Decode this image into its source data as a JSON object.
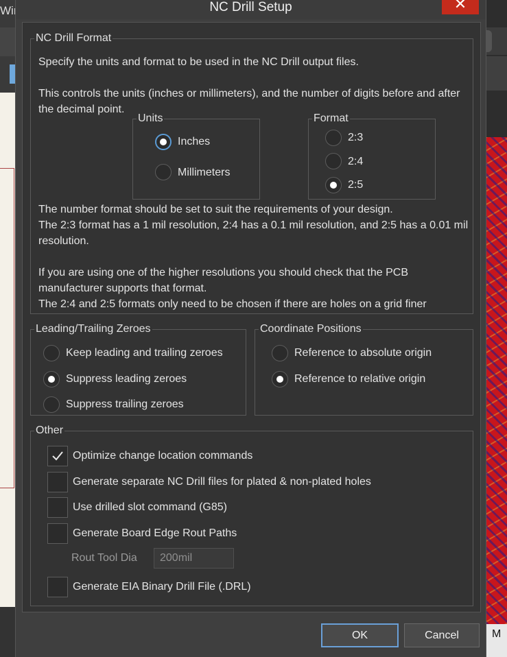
{
  "background": {
    "left_title": "Wir",
    "right_label": "M"
  },
  "dialog": {
    "title": "NC Drill Setup",
    "close_glyph": "✕",
    "ok_label": "OK",
    "cancel_label": "Cancel"
  },
  "nc_format": {
    "legend": "NC Drill Format",
    "desc1": "Specify the units and format to be used in the NC Drill output files.",
    "desc2": "This controls the units (inches or millimeters), and the number of digits before and after the decimal point.",
    "units": {
      "legend": "Units",
      "options": [
        {
          "label": "Inches",
          "selected": true
        },
        {
          "label": "Millimeters",
          "selected": false
        }
      ]
    },
    "format": {
      "legend": "Format",
      "options": [
        {
          "label": "2:3",
          "selected": false
        },
        {
          "label": "2:4",
          "selected": false
        },
        {
          "label": "2:5",
          "selected": true
        }
      ]
    },
    "note1": "The number format should be set to suit the requirements of your design.",
    "note2": "The 2:3 format has a 1 mil resolution, 2:4 has a 0.1 mil resolution, and 2:5 has a 0.01 mil resolution.",
    "note3": "If you are using one of the higher resolutions you should check that the PCB manufacturer supports that format.",
    "note4": "The 2:4 and 2:5 formats only need to be chosen if there are holes on a grid finer"
  },
  "zeroes": {
    "legend": "Leading/Trailing Zeroes",
    "options": [
      {
        "label": "Keep leading and trailing zeroes",
        "selected": false
      },
      {
        "label": "Suppress leading zeroes",
        "selected": true
      },
      {
        "label": "Suppress trailing zeroes",
        "selected": false
      }
    ]
  },
  "coords": {
    "legend": "Coordinate Positions",
    "options": [
      {
        "label": "Reference to absolute origin",
        "selected": false
      },
      {
        "label": "Reference to relative origin",
        "selected": true
      }
    ]
  },
  "other": {
    "legend": "Other",
    "items": [
      {
        "label": "Optimize change location commands",
        "checked": true
      },
      {
        "label": "Generate separate NC Drill files for plated & non-plated holes",
        "checked": false
      },
      {
        "label": "Use drilled slot command (G85)",
        "checked": false
      },
      {
        "label": "Generate Board Edge Rout Paths",
        "checked": false
      }
    ],
    "rout_tool_label": "Rout Tool Dia",
    "rout_tool_value": "200mil",
    "eia_label": "Generate EIA Binary Drill File (.DRL)",
    "eia_checked": false
  }
}
